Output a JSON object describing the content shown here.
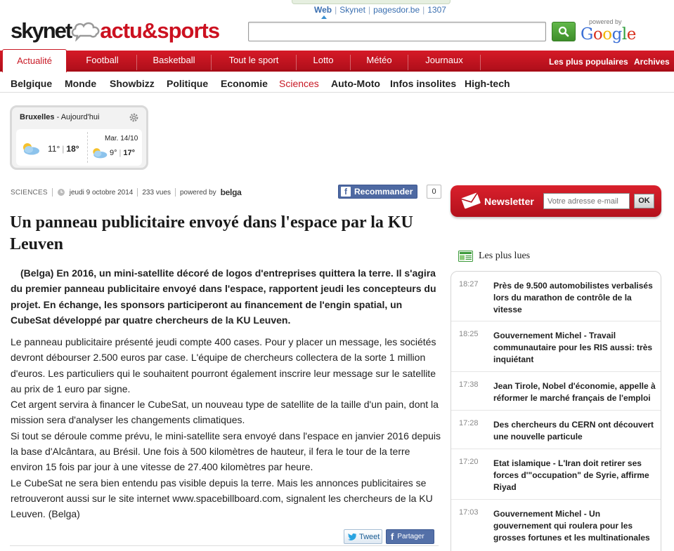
{
  "search_tabs": {
    "web": "Web",
    "skynet": "Skynet",
    "pagesdor": "pagesdor.be",
    "number": "1307"
  },
  "logo": {
    "part1": "skynet",
    "part2": "actu&sports"
  },
  "search": {
    "placeholder": "",
    "powered_by": "powered by",
    "google": "Google"
  },
  "main_nav": {
    "active": "Actualité",
    "items": [
      "Football",
      "Basketball",
      "Tout le sport",
      "Lotto",
      "Météo",
      "Journaux"
    ],
    "right": [
      "Les plus populaires",
      "Archives"
    ]
  },
  "sub_nav": {
    "items": [
      "Belgique",
      "Monde",
      "Showbizz",
      "Politique",
      "Economie",
      "Sciences",
      "Auto-Moto",
      "Infos insolites",
      "High-tech"
    ],
    "active": "Sciences"
  },
  "weather": {
    "city": "Bruxelles",
    "period": " - Aujourd'hui",
    "today_min": "11°",
    "today_max": "18°",
    "next_date": "Mar. 14/10",
    "next_min": "9°",
    "next_max": "17°"
  },
  "article": {
    "category": "SCIENCES",
    "date": "jeudi 9 octobre 2014",
    "views": "233 vues",
    "powered_by": "powered by",
    "source": "belga",
    "recommend": "Recommander",
    "recommend_count": "0",
    "title": "Un panneau publicitaire envoyé dans l'espace par la KU Leuven",
    "lead": "(Belga) En 2016, un mini-satellite décoré de logos d'entreprises quittera la terre. Il s'agira du premier panneau publicitaire envoyé dans l'espace, rapportent jeudi les concepteurs du projet. En échange, les sponsors participeront au financement de l'engin spatial, un CubeSat développé par quatre chercheurs de la KU Leuven.",
    "paragraphs": [
      "Le panneau publicitaire présenté jeudi compte 400 cases. Pour y placer un message, les sociétés devront débourser 2.500 euros par case. L'équipe de chercheurs collectera de la sorte 1 million d'euros. Les particuliers qui le souhaitent pourront également inscrire leur message sur le satellite au prix de 1 euro par signe.",
      "Cet argent servira à financer le CubeSat, un nouveau type de satellite de la taille d'un pain, dont la mission sera d'analyser les changements climatiques.",
      "Si tout se déroule comme prévu, le mini-satellite sera envoyé dans l'espace en janvier 2016 depuis la base d'Alcântara, au Brésil. Une fois à 500 kilomètres de hauteur, il fera le tour de la terre environ 15 fois par jour à une vitesse de 27.400 kilomètres par heure.",
      "Le CubeSat ne sera bien entendu pas visible depuis la terre. Mais les annonces publicitaires se retrouveront aussi sur le site internet www.spacebillboard.com, signalent les chercheurs de la KU Leuven. (Belga)"
    ],
    "tweet": "Tweet",
    "share": "Partager"
  },
  "newsletter": {
    "label": "Newsletter",
    "placeholder": "Votre adresse e-mail",
    "ok": "OK"
  },
  "most_read": {
    "title": "Les plus lues",
    "items": [
      {
        "time": "18:27",
        "text": "Près de 9.500 automobilistes verbalisés lors du marathon de contrôle de la vitesse"
      },
      {
        "time": "18:25",
        "text": "Gouvernement Michel - Travail communautaire pour les RIS aussi: très inquiétant"
      },
      {
        "time": "17:38",
        "text": "Jean Tirole, Nobel d'économie, appelle à réformer le marché français de l'emploi"
      },
      {
        "time": "17:28",
        "text": "Des chercheurs du CERN ont découvert une nouvelle particule"
      },
      {
        "time": "17:20",
        "text": "Etat islamique - L'Iran doit retirer ses forces d'\"occupation\" de Syrie, affirme Riyad"
      },
      {
        "time": "17:03",
        "text": "Gouvernement Michel - Un gouvernement qui roulera pour les grosses fortunes et les multinationales"
      }
    ]
  },
  "colors": {
    "brand_red": "#c81824",
    "link_blue": "#3a6fb0",
    "facebook": "#4e69a2",
    "search_green": "#4ea83a"
  }
}
